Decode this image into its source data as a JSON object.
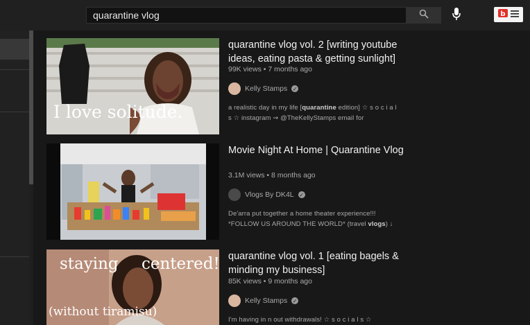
{
  "search": {
    "query": "quarantine vlog"
  },
  "results": [
    {
      "title": "quarantine vlog vol. 2 [writing youtube ideas, eating pasta & getting sunlight]",
      "meta": "99K views • 7 months ago",
      "channel": "Kelly Stamps",
      "desc_pre": "a realistic day in my life [",
      "desc_bold": "quarantine",
      "desc_post": " edition] ☆ s o c i a l s ☆ instagram ⇝ @TheKellyStamps email for",
      "thumb_text": "I love solitude."
    },
    {
      "title": "Movie Night At Home | Quarantine Vlog",
      "meta": "3.1M views • 8 months ago",
      "channel": "Vlogs By DK4L",
      "desc_pre": "De'arra put together a home theater experience!!! *FOLLOW US AROUND THE WORLD* (travel ",
      "desc_bold": "vlogs",
      "desc_post": ") ↓",
      "thumb_text": ""
    },
    {
      "title": "quarantine vlog vol. 1 [eating bagels & minding my business]",
      "meta": "85K views • 9 months ago",
      "channel": "Kelly Stamps",
      "desc_pre": "I'm having in n out withdrawals! ☆ s o c i a l s ☆",
      "desc_bold": "",
      "desc_post": "",
      "thumb_text_left": "staying",
      "thumb_text_right": "centered!",
      "thumb_text_bottom": "(without tiramisu)"
    }
  ],
  "icons": {
    "search": "search-icon",
    "mic": "microphone-icon",
    "extension": "extension-icon"
  }
}
